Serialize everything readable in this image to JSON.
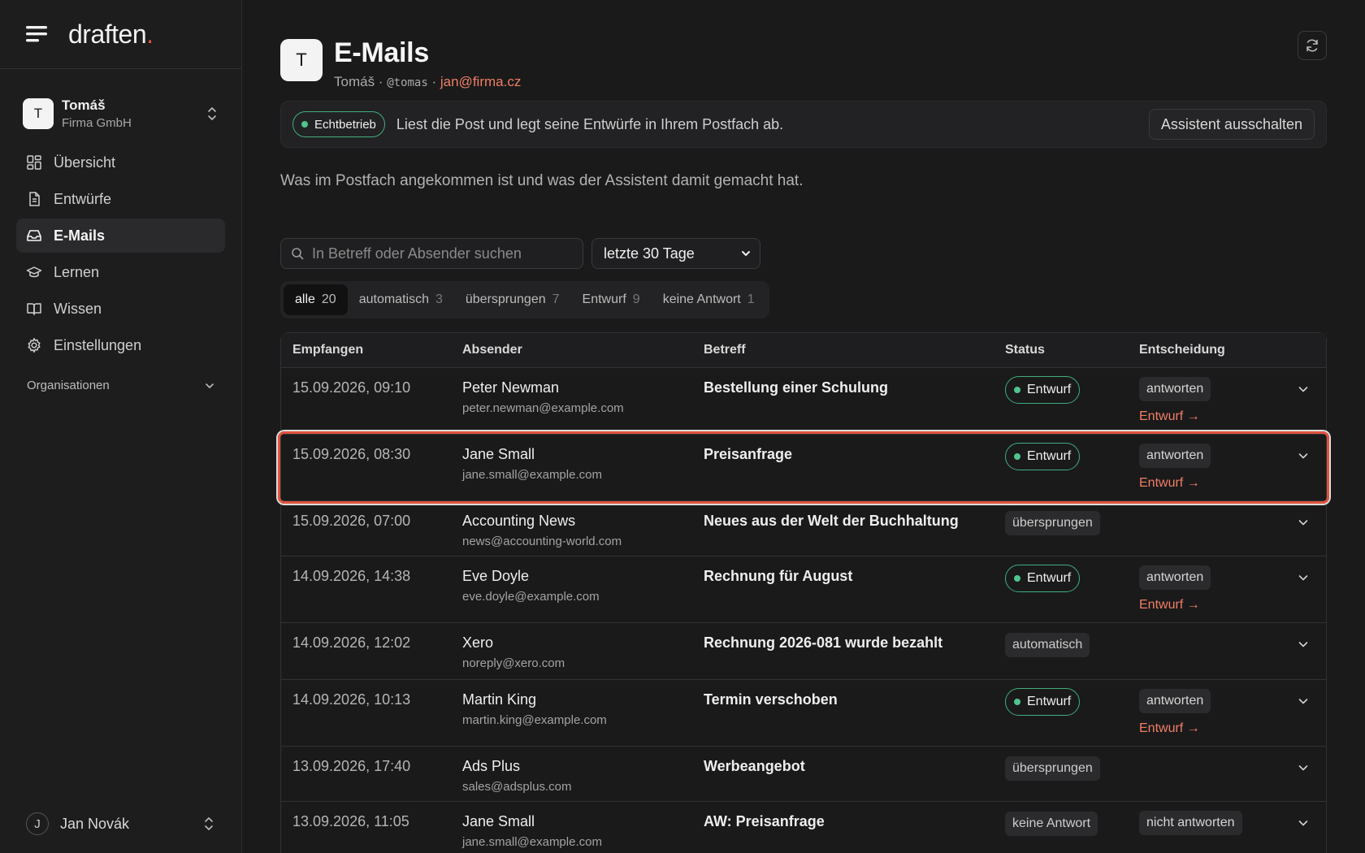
{
  "brand": {
    "name": "draften",
    "dot": "."
  },
  "org": {
    "initial": "T",
    "name": "Tomáš",
    "company": "Firma GmbH"
  },
  "nav": [
    {
      "label": "Übersicht",
      "icon": "dashboard-icon"
    },
    {
      "label": "Entwürfe",
      "icon": "document-icon"
    },
    {
      "label": "E-Mails",
      "icon": "inbox-icon"
    },
    {
      "label": "Lernen",
      "icon": "graduation-cap-icon"
    },
    {
      "label": "Wissen",
      "icon": "book-icon"
    },
    {
      "label": "Einstellungen",
      "icon": "gear-icon"
    }
  ],
  "organizations_label": "Organisationen",
  "user": {
    "initial": "J",
    "name": "Jan Novák"
  },
  "header": {
    "initial": "T",
    "title": "E-Mails",
    "name": "Tomáš",
    "sep1": " · ",
    "handle": "@tomas",
    "sep2": " · ",
    "email": "jan@firma.cz"
  },
  "banner": {
    "badge": "Echtbetrieb",
    "text": "Liest die Post und legt seine Entwürfe in Ihrem Postfach ab.",
    "button": "Assistent ausschalten"
  },
  "description": "Was im Postfach angekommen ist und was der Assistent damit gemacht hat.",
  "search": {
    "placeholder": "In Betreff oder Absender suchen"
  },
  "range": {
    "value": "letzte 30 Tage"
  },
  "segments": [
    {
      "label": "alle",
      "count": "20"
    },
    {
      "label": "automatisch",
      "count": "3"
    },
    {
      "label": "übersprungen",
      "count": "7"
    },
    {
      "label": "Entwurf",
      "count": "9"
    },
    {
      "label": "keine Antwort",
      "count": "1"
    }
  ],
  "columns": {
    "received": "Empfangen",
    "sender": "Absender",
    "subject": "Betreff",
    "status": "Status",
    "decision": "Entscheidung"
  },
  "rows": [
    {
      "date": "15.09.2026, 09:10",
      "name": "Peter Newman",
      "email": "peter.newman@example.com",
      "subject": "Bestellung einer Schulung",
      "status": "Entwurf",
      "decision": "antworten",
      "link": "Entwurf →"
    },
    {
      "date": "15.09.2026, 08:30",
      "name": "Jane Small",
      "email": "jane.small@example.com",
      "subject": "Preisanfrage",
      "status": "Entwurf",
      "decision": "antworten",
      "link": "Entwurf →"
    },
    {
      "date": "15.09.2026, 07:00",
      "name": "Accounting News",
      "email": "news@accounting-world.com",
      "subject": "Neues aus der Welt der Buchhaltung",
      "status": "übersprungen",
      "decision": "",
      "link": ""
    },
    {
      "date": "14.09.2026, 14:38",
      "name": "Eve Doyle",
      "email": "eve.doyle@example.com",
      "subject": "Rechnung für August",
      "status": "Entwurf",
      "decision": "antworten",
      "link": "Entwurf →"
    },
    {
      "date": "14.09.2026, 12:02",
      "name": "Xero",
      "email": "noreply@xero.com",
      "subject": "Rechnung 2026-081 wurde bezahlt",
      "status": "automatisch",
      "decision": "",
      "link": ""
    },
    {
      "date": "14.09.2026, 10:13",
      "name": "Martin King",
      "email": "martin.king@example.com",
      "subject": "Termin verschoben",
      "status": "Entwurf",
      "decision": "antworten",
      "link": "Entwurf →"
    },
    {
      "date": "13.09.2026, 17:40",
      "name": "Ads Plus",
      "email": "sales@adsplus.com",
      "subject": "Werbeangebot",
      "status": "übersprungen",
      "decision": "",
      "link": ""
    },
    {
      "date": "13.09.2026, 11:05",
      "name": "Jane Small",
      "email": "jane.small@example.com",
      "subject": "AW: Preisanfrage",
      "status": "keine Antwort",
      "decision": "nicht antworten",
      "link": ""
    }
  ]
}
